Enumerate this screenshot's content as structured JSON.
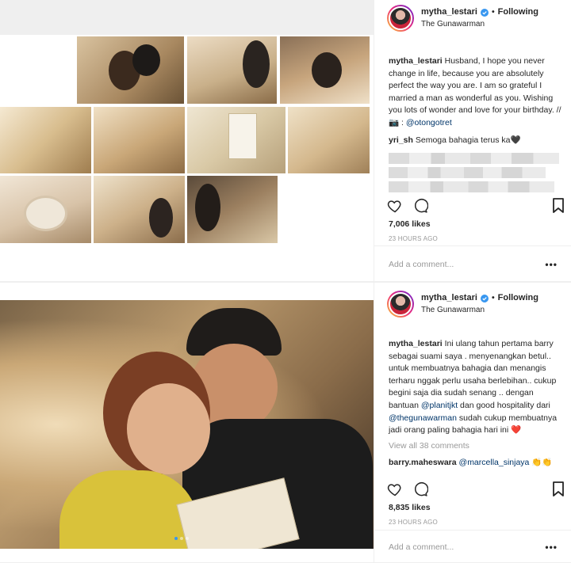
{
  "posts": [
    {
      "user": "mytha_lestari",
      "follow_state": "Following",
      "location": "The Gunawarman",
      "caption_user": "mytha_lestari",
      "caption_text": "Husband, I hope you never change in life, because you are absolutely perfect the way you are. I am so grateful I married a man as wonderful as you. Wishing you lots of wonder and love for your birthday. // 📷 : ",
      "caption_mention": "@otongotret",
      "comments": [
        {
          "user": "yri_sh",
          "text": "Semoga bahagia terus ka🖤"
        }
      ],
      "likes": "7,006 likes",
      "time_ago": "23 HOURS AGO",
      "add_comment_placeholder": "Add a comment..."
    },
    {
      "user": "mytha_lestari",
      "follow_state": "Following",
      "location": "The Gunawarman",
      "caption_user": "mytha_lestari",
      "caption_parts": {
        "p1": "Ini ulang tahun pertama barry sebagai suami saya . menyenangkan betul.. untuk membuatnya bahagia dan menangis terharu nggak perlu usaha berlebihan.. cukup begini saja dia sudah senang .. dengan bantuan ",
        "m1": "@planitjkt",
        "p2": " dan good hospitality dari ",
        "m2": "@thegunawarman",
        "p3": " sudah cukup membuatnya jadi orang paling bahagia hari ini ",
        "heart": "❤️"
      },
      "view_all": "View all 38 comments",
      "comments": [
        {
          "user": "barry.maheswara",
          "mention": "@marcella_sinjaya",
          "text": " 👏👏"
        }
      ],
      "likes": "8,835 likes",
      "time_ago": "23 HOURS AGO",
      "add_comment_placeholder": "Add a comment..."
    }
  ],
  "icons": {
    "verified": "verified-badge-icon",
    "like": "heart-outline-icon",
    "comment": "comment-bubble-icon",
    "save": "bookmark-icon",
    "more": "more-options-icon"
  },
  "colors": {
    "accent_blue": "#3897f0",
    "mention": "#003569",
    "text": "#262626",
    "muted": "#999999"
  }
}
